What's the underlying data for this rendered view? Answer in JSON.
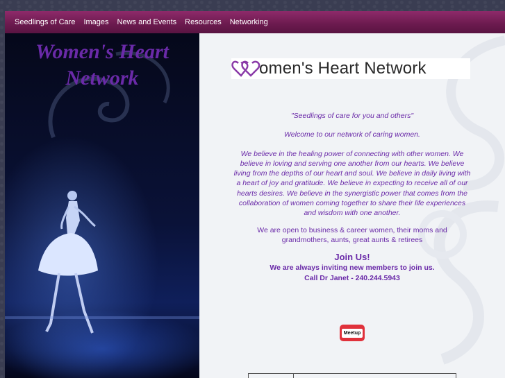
{
  "nav": {
    "items": [
      {
        "label": "Seedlings of Care"
      },
      {
        "label": "Images"
      },
      {
        "label": "News and Events"
      },
      {
        "label": "Resources"
      },
      {
        "label": "Networking"
      }
    ]
  },
  "sidebar": {
    "title": "Women's Heart Network"
  },
  "main": {
    "logo_text": "omen's Heart Network",
    "tagline": "\"Seedlings of care for you and others\"",
    "welcome": "Welcome to our network of caring women.",
    "beliefs": "We believe in the healing power of connecting with other women.  We believe in loving and serving one another from our hearts.  We believe living from the depths of our heart and soul.  We believe in daily living with a heart of joy and gratitude.  We believe in expecting to receive all of our hearts desires.  We believe in the synergistic power that comes from the collaboration of women coming together to share their life experiences and wisdom with one another.",
    "audience": "We are open to business & career women, their moms and grandmothers, aunts, great aunts & retirees",
    "join_heading": "Join Us!",
    "invite": "We are always inviting new members to join us.",
    "call": "Call Dr Janet - 240.244.5943",
    "meetup_label": "Meetup"
  },
  "colors": {
    "nav_bg": "#6b1a4e",
    "text_purple": "#6a2aa8",
    "logo_heart": "#8a3aa8"
  }
}
